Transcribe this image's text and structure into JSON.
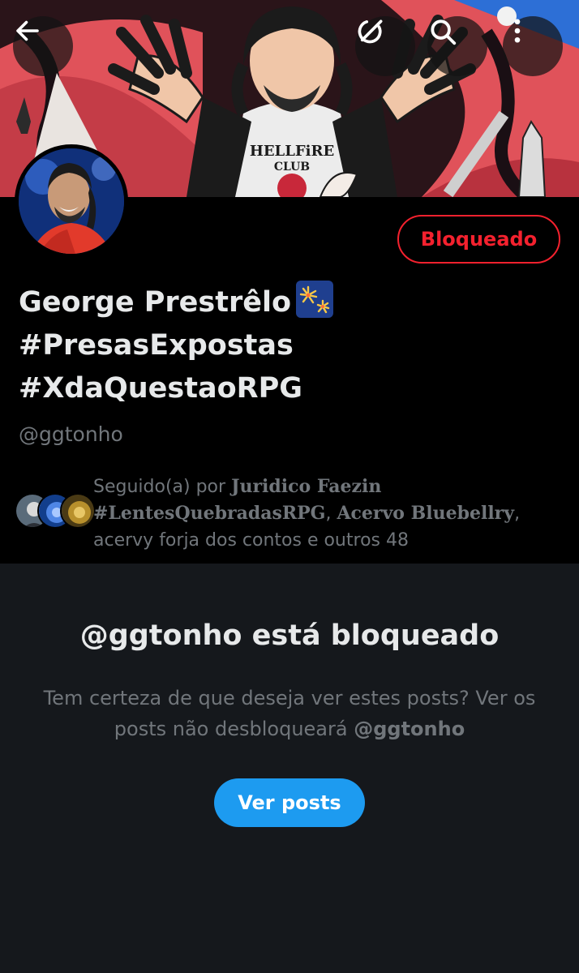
{
  "profile": {
    "name_line1": "George Prestrêlo",
    "name_line2": "#PresasExpostas",
    "name_line3": "#XdaQuestaoRPG",
    "handle": "@ggtonho",
    "blocked_button": "Bloqueado"
  },
  "banner": {
    "shirt_text_1": "HELLFiRE",
    "shirt_text_2": "CLUB"
  },
  "followers": {
    "prefix": "Seguido(a) por",
    "name1": "Juridico Faezin",
    "name2": "#LentesQuebradasRPG",
    "name3": "Acervo Bluebellry",
    "rest": ", acervy forja dos contos e outros 48"
  },
  "blocked_panel": {
    "title": "@ggtonho está bloqueado",
    "text": "Tem certeza de que deseja ver estes posts? Ver os posts não desbloqueará",
    "text_handle": "@ggtonho",
    "view_button": "Ver posts"
  },
  "icons": [
    "back-arrow-icon",
    "grok-icon",
    "search-icon",
    "more-options-icon",
    "fireworks-emoji-icon"
  ],
  "colors": {
    "background": "#000000",
    "panel": "#15181c",
    "blocked_red": "#f4212e",
    "accent_blue": "#1d9bf0",
    "secondary_text": "#71767b",
    "primary_text": "#e7e9ea"
  }
}
